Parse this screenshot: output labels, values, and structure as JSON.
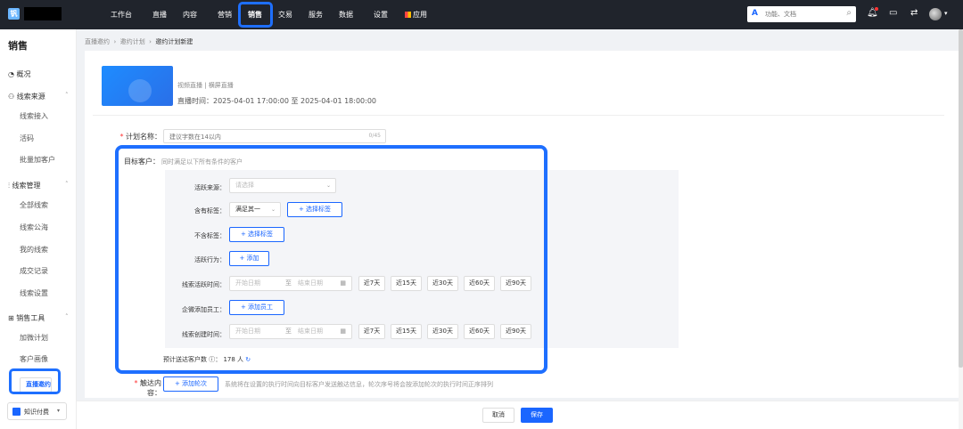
{
  "topbar": {
    "logo_glyph": "钒",
    "nav": [
      "工作台",
      "直播",
      "内容",
      "营销",
      "销售",
      "交易",
      "服务",
      "数据",
      "设置",
      "应用"
    ],
    "active": "销售",
    "search_brand": "A",
    "search_placeholder": "功能、文档",
    "icons": [
      "search-icon",
      "bell-icon",
      "inbox-icon",
      "swap-icon",
      "avatar",
      "chevron-down-icon"
    ]
  },
  "sidebar": {
    "title": "销售",
    "overview": "概况",
    "sec1": "线索来源",
    "sec1_items": [
      "线索接入",
      "活码",
      "批量加客户"
    ],
    "sec2": "线索管理",
    "sec2_items": [
      "全部线索",
      "线索公海",
      "我的线索",
      "成交记录",
      "线索设置"
    ],
    "sec3": "销售工具",
    "sec3_items": [
      "加微计划",
      "客户画像",
      "直播邀约"
    ],
    "selected": "直播邀约",
    "knowledge": "知识付费"
  },
  "breadcrumb": [
    "直播邀约",
    "邀约计划",
    "邀约计划新建"
  ],
  "live": {
    "type": "视频直播 | 横屏直播",
    "time": "直播时间：2025-04-01 17:00:00 至 2025-04-01 18:00:00"
  },
  "form": {
    "plan_name_label": "计划名称：",
    "plan_name_placeholder": "建议字数在14以内",
    "plan_name_count": "0/45",
    "target_label": "目标客户：",
    "target_hint": "同时满足以下所有条件的客户",
    "active_source_label": "活跃来源：",
    "active_source_placeholder": "请选择",
    "has_tag_label": "含有标签：",
    "has_tag_mode": "满足其一",
    "select_tag_btn": "+ 选择标签",
    "no_tag_label": "不含标签：",
    "active_action_label": "活跃行为：",
    "add_btn": "+ 添加",
    "lead_active_time_label": "线索活跃时间：",
    "start_date": "开始日期",
    "to": "至",
    "end_date": "结束日期",
    "quick": [
      "近7天",
      "近15天",
      "近30天",
      "近60天",
      "近90天"
    ],
    "wecom_staff_label": "企微添加员工：",
    "add_staff_btn": "+ 添加员工",
    "lead_create_time_label": "线索创建时间：",
    "estimate_label": "预计送达客户数",
    "estimate_value": "178 人",
    "touch_label": "触达内容：",
    "add_round_btn": "+ 添加轮次",
    "touch_hint": "系统将在设置的执行时间向目标客户发送触达信息，轮次序号将会按添加轮次的执行时间正序排列"
  },
  "footer": {
    "cancel": "取消",
    "save": "保存"
  },
  "colors": {
    "primary": "#1a66ff",
    "topbar": "#20242c",
    "highlight": "#1e6fff"
  }
}
